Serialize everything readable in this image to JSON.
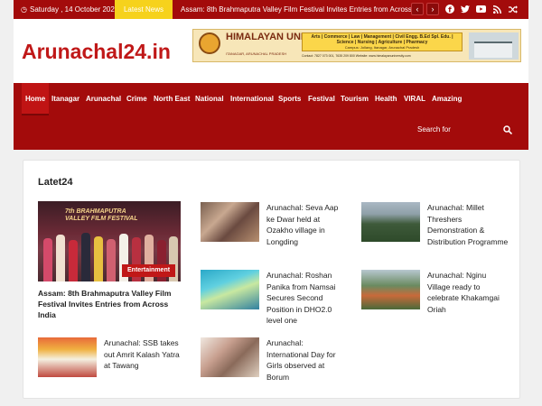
{
  "topbar": {
    "date": "Saturday , 14 October 2023",
    "latest_label": "Latest News",
    "ticker": "Assam: 8th Brahmaputra Valley Film Festival Invites Entries from Across India",
    "prev_icon": "chevron-left-icon",
    "next_icon": "chevron-right-icon",
    "social": [
      "facebook-icon",
      "twitter-icon",
      "youtube-icon",
      "rss-icon",
      "shuffle-icon"
    ],
    "accent": "#a30b0b",
    "latest_color": "#f6d21c"
  },
  "header": {
    "logo": "Arunachal24.in",
    "banner": {
      "university": "HIMALAYAN UNIVERSITY",
      "location": "ITANAGAR, ARUNACHAL PRADESH",
      "courses": "Arts | Commerce | Law | Management | Civil Engg. B.Ed Spl. Edu. | Science | Nursing | Agriculture | Pharmacy",
      "campus": "Campus: Jollang, Itanagar, Arunachal Pradesh",
      "contact": "Contact: 7827 073 001, 7635 209 800     Website: www.himalayanuniversity.com"
    }
  },
  "nav": {
    "items": [
      "Home",
      "Itanagar",
      "Arunachal",
      "Crime",
      "North East",
      "National",
      "International",
      "Sports",
      "Festival",
      "Tourism",
      "Health",
      "VIRAL",
      "Amazing"
    ],
    "search_placeholder": "Search for"
  },
  "main": {
    "section_title": "Latet24",
    "featured": {
      "badge": "Entertainment",
      "image_caption": "7th BRAHMAPUTRA VALLEY FILM FESTIVAL",
      "title": "Assam: 8th Brahmaputra Valley Film Festival Invites Entries from Across India"
    },
    "posts": [
      {
        "title": "Arunachal: Seva Aap ke Dwar held at Ozakho village in Longding"
      },
      {
        "title": "Arunachal: Millet Threshers Demonstration & Distribution Programme"
      },
      {
        "title": "Arunachal: Roshan Panika from Namsai Secures Second Position in DHO2.0 level one"
      },
      {
        "title": "Arunachal: Nginu Village ready to celebrate Khakamgai Oriah"
      },
      {
        "title": "Arunachal: SSB takes out Amrit Kalash Yatra at Tawang"
      },
      {
        "title": "Arunachal: International Day for Girls observed at Borum"
      }
    ]
  }
}
